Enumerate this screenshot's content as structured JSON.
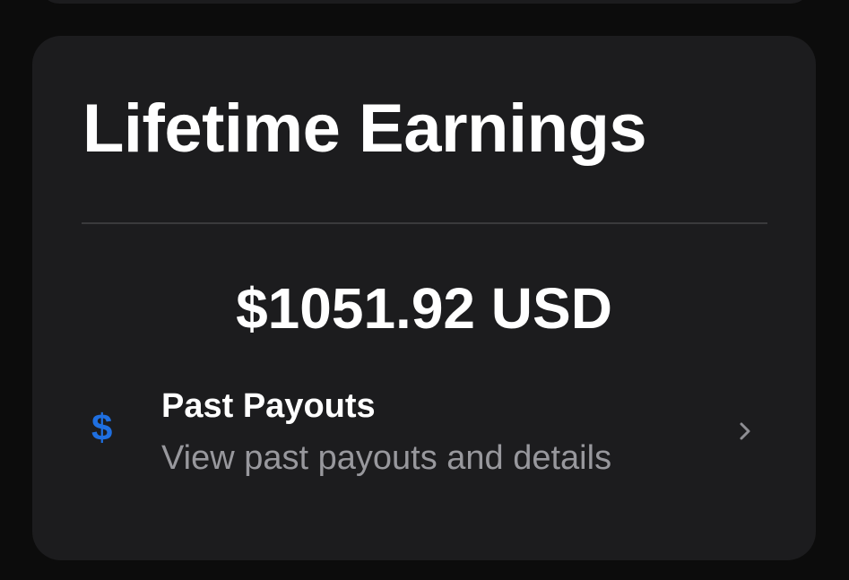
{
  "card": {
    "title": "Lifetime Earnings",
    "amount": "$1051.92 USD"
  },
  "past_payouts": {
    "icon": "dollar-icon",
    "icon_glyph": "$",
    "icon_color": "#1f6fe0",
    "title": "Past Payouts",
    "subtitle": "View past payouts and details",
    "chevron": "chevron-right-icon"
  }
}
